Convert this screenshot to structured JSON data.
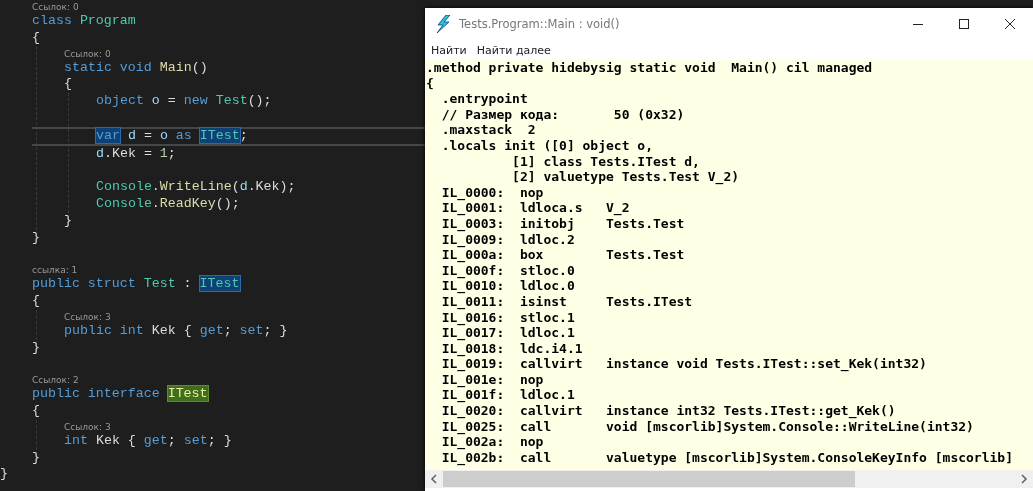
{
  "editor": {
    "lines": [
      {
        "kind": "block",
        "children": [
          {
            "kind": "code",
            "codelens": "Ссылок: 0",
            "current": false,
            "tokens": [
              {
                "kind": "keyword",
                "text": "class "
              },
              {
                "kind": "type",
                "text": "Program"
              }
            ]
          },
          {
            "kind": "code",
            "current": false,
            "tokens": [
              {
                "kind": "plain",
                "text": "{"
              }
            ]
          },
          {
            "kind": "block",
            "children": [
              {
                "kind": "code",
                "codelens": "Ссылок: 0",
                "current": false,
                "tokens": [
                  {
                    "kind": "keyword",
                    "text": "static void "
                  },
                  {
                    "kind": "method",
                    "text": "Main"
                  },
                  {
                    "kind": "plain",
                    "text": "()"
                  }
                ]
              },
              {
                "kind": "code",
                "current": false,
                "tokens": [
                  {
                    "kind": "plain",
                    "text": "{"
                  }
                ]
              },
              {
                "kind": "block",
                "children": [
                  {
                    "kind": "code",
                    "current": false,
                    "tokens": [
                      {
                        "kind": "keyword",
                        "text": "object "
                      },
                      {
                        "kind": "variable",
                        "text": "o"
                      },
                      {
                        "kind": "plain",
                        "text": " = "
                      },
                      {
                        "kind": "keyword",
                        "text": "new "
                      },
                      {
                        "kind": "type",
                        "text": "Test"
                      },
                      {
                        "kind": "plain",
                        "text": "();"
                      }
                    ]
                  },
                  {
                    "kind": "blank"
                  },
                  {
                    "kind": "code",
                    "current": true,
                    "tokens": [
                      {
                        "kind": "keyword",
                        "text": "var",
                        "reference_highlight": true
                      },
                      {
                        "kind": "variable",
                        "text": " d"
                      },
                      {
                        "kind": "plain",
                        "text": " = "
                      },
                      {
                        "kind": "variable",
                        "text": "o "
                      },
                      {
                        "kind": "keyword",
                        "text": "as "
                      },
                      {
                        "kind": "type",
                        "text": "ITest",
                        "reference_highlight": true
                      },
                      {
                        "kind": "plain",
                        "text": ";"
                      }
                    ]
                  },
                  {
                    "kind": "code",
                    "current": false,
                    "tokens": [
                      {
                        "kind": "variable",
                        "text": "d"
                      },
                      {
                        "kind": "plain",
                        "text": ".Kek = "
                      },
                      {
                        "kind": "number",
                        "text": "1"
                      },
                      {
                        "kind": "plain",
                        "text": ";"
                      }
                    ]
                  },
                  {
                    "kind": "blank"
                  },
                  {
                    "kind": "code",
                    "current": false,
                    "tokens": [
                      {
                        "kind": "type",
                        "text": "Console"
                      },
                      {
                        "kind": "plain",
                        "text": "."
                      },
                      {
                        "kind": "method",
                        "text": "WriteLine"
                      },
                      {
                        "kind": "plain",
                        "text": "("
                      },
                      {
                        "kind": "variable",
                        "text": "d"
                      },
                      {
                        "kind": "plain",
                        "text": ".Kek);"
                      }
                    ]
                  },
                  {
                    "kind": "code",
                    "current": false,
                    "tokens": [
                      {
                        "kind": "type",
                        "text": "Console"
                      },
                      {
                        "kind": "plain",
                        "text": "."
                      },
                      {
                        "kind": "method",
                        "text": "ReadKey"
                      },
                      {
                        "kind": "plain",
                        "text": "();"
                      }
                    ]
                  }
                ]
              },
              {
                "kind": "code",
                "current": false,
                "tokens": [
                  {
                    "kind": "plain",
                    "text": "}"
                  }
                ]
              }
            ]
          },
          {
            "kind": "code",
            "current": false,
            "tokens": [
              {
                "kind": "plain",
                "text": "}"
              }
            ]
          },
          {
            "kind": "blank"
          },
          {
            "kind": "code",
            "codelens": "ссылка: 1",
            "current": false,
            "tokens": [
              {
                "kind": "keyword",
                "text": "public struct "
              },
              {
                "kind": "type",
                "text": "Test"
              },
              {
                "kind": "plain",
                "text": " : "
              },
              {
                "kind": "type",
                "text": "ITest",
                "reference_highlight": true
              }
            ]
          },
          {
            "kind": "code",
            "current": false,
            "tokens": [
              {
                "kind": "plain",
                "text": "{"
              }
            ]
          },
          {
            "kind": "block",
            "children": [
              {
                "kind": "code",
                "codelens": "Ссылок: 3",
                "current": false,
                "tokens": [
                  {
                    "kind": "keyword",
                    "text": "public int "
                  },
                  {
                    "kind": "plain",
                    "text": "Kek { "
                  },
                  {
                    "kind": "keyword",
                    "text": "get"
                  },
                  {
                    "kind": "plain",
                    "text": "; "
                  },
                  {
                    "kind": "keyword",
                    "text": "set"
                  },
                  {
                    "kind": "plain",
                    "text": "; }"
                  }
                ]
              }
            ]
          },
          {
            "kind": "code",
            "current": false,
            "tokens": [
              {
                "kind": "plain",
                "text": "}"
              }
            ]
          },
          {
            "kind": "blank"
          },
          {
            "kind": "code",
            "codelens": "Ссылок: 2",
            "current": false,
            "tokens": [
              {
                "kind": "keyword",
                "text": "public interface "
              },
              {
                "kind": "type",
                "text": "ITest",
                "definition_highlight": true
              }
            ]
          },
          {
            "kind": "code",
            "current": false,
            "tokens": [
              {
                "kind": "plain",
                "text": "{"
              }
            ]
          },
          {
            "kind": "block",
            "children": [
              {
                "kind": "code",
                "codelens": "Ссылок: 3",
                "current": false,
                "tokens": [
                  {
                    "kind": "keyword",
                    "text": "int "
                  },
                  {
                    "kind": "plain",
                    "text": "Kek { "
                  },
                  {
                    "kind": "keyword",
                    "text": "get"
                  },
                  {
                    "kind": "plain",
                    "text": "; "
                  },
                  {
                    "kind": "keyword",
                    "text": "set"
                  },
                  {
                    "kind": "plain",
                    "text": "; }"
                  }
                ]
              }
            ]
          },
          {
            "kind": "code",
            "current": false,
            "tokens": [
              {
                "kind": "plain",
                "text": "}"
              }
            ]
          }
        ]
      },
      {
        "kind": "code",
        "current": false,
        "tokens": [
          {
            "kind": "plain",
            "text": "}"
          }
        ]
      }
    ]
  },
  "ildasm_window": {
    "title": "Tests.Program::Main : void()",
    "menu": [
      "Найти",
      "Найти далее"
    ],
    "lines": [
      ".method private hidebysig static void  Main() cil managed",
      "{",
      "  .entrypoint",
      "  // Размер кода:       50 (0x32)",
      "  .maxstack  2",
      "  .locals init ([0] object o,",
      "           [1] class Tests.ITest d,",
      "           [2] valuetype Tests.Test V_2)",
      "  IL_0000:  nop",
      "  IL_0001:  ldloca.s   V_2",
      "  IL_0003:  initobj    Tests.Test",
      "  IL_0009:  ldloc.2",
      "  IL_000a:  box        Tests.Test",
      "  IL_000f:  stloc.0",
      "  IL_0010:  ldloc.0",
      "  IL_0011:  isinst     Tests.ITest",
      "  IL_0016:  stloc.1",
      "  IL_0017:  ldloc.1",
      "  IL_0018:  ldc.i4.1",
      "  IL_0019:  callvirt   instance void Tests.ITest::set_Kek(int32)",
      "  IL_001e:  nop",
      "  IL_001f:  ldloc.1",
      "  IL_0020:  callvirt   instance int32 Tests.ITest::get_Kek()",
      "  IL_0025:  call       void [mscorlib]System.Console::WriteLine(int32)",
      "  IL_002a:  nop",
      "  IL_002b:  call       valuetype [mscorlib]System.ConsoleKeyInfo [mscorlib]"
    ]
  }
}
